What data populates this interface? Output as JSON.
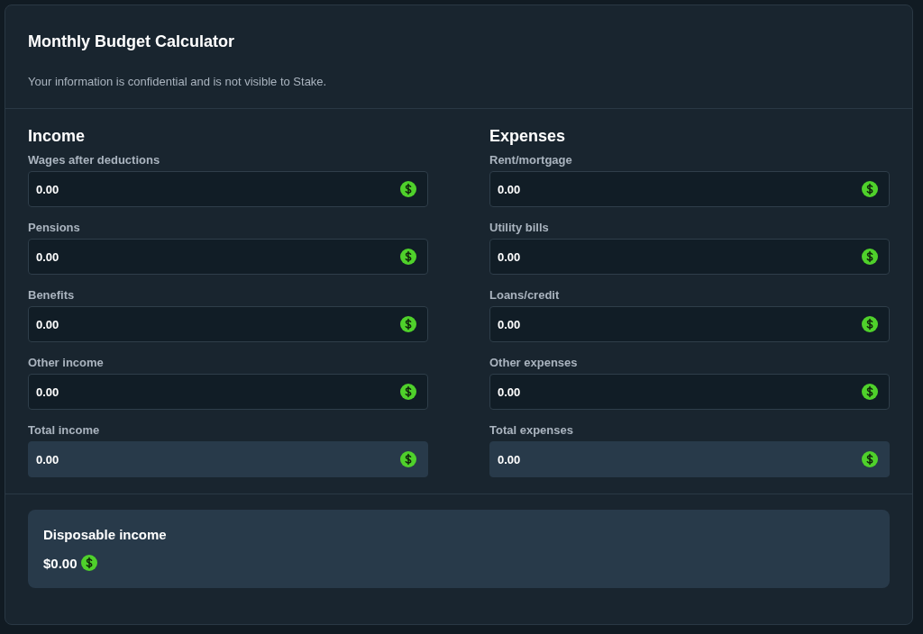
{
  "title": "Monthly Budget Calculator",
  "subtitle": "Your information is confidential and is not visible to Stake.",
  "columns": [
    {
      "heading": "Income",
      "fields": [
        {
          "label": "Wages after deductions",
          "value": "0.00",
          "kind": "input"
        },
        {
          "label": "Pensions",
          "value": "0.00",
          "kind": "input"
        },
        {
          "label": "Benefits",
          "value": "0.00",
          "kind": "input"
        },
        {
          "label": "Other income",
          "value": "0.00",
          "kind": "input"
        },
        {
          "label": "Total income",
          "value": "0.00",
          "kind": "total"
        }
      ]
    },
    {
      "heading": "Expenses",
      "fields": [
        {
          "label": "Rent/mortgage",
          "value": "0.00",
          "kind": "input"
        },
        {
          "label": "Utility bills",
          "value": "0.00",
          "kind": "input"
        },
        {
          "label": "Loans/credit",
          "value": "0.00",
          "kind": "input"
        },
        {
          "label": "Other expenses",
          "value": "0.00",
          "kind": "input"
        },
        {
          "label": "Total expenses",
          "value": "0.00",
          "kind": "total"
        }
      ]
    }
  ],
  "summary": {
    "label": "Disposable income",
    "value": "$0.00"
  }
}
